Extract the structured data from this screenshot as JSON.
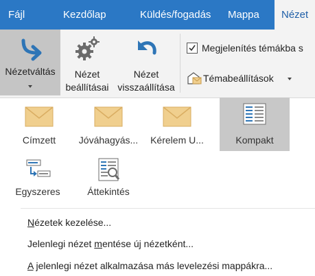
{
  "tabs": [
    {
      "label": "Fájl"
    },
    {
      "label": "Kezdőlap"
    },
    {
      "label": "Küldés/fogadás"
    },
    {
      "label": "Mappa"
    },
    {
      "label": "Nézet"
    }
  ],
  "ribbon": {
    "change_view": {
      "label": "Nézetváltás"
    },
    "view_settings": {
      "line1": "Nézet",
      "line2": "beállításai"
    },
    "reset_view": {
      "line1": "Nézet",
      "line2": "visszaállítása"
    },
    "show_as_conversations": {
      "label": "Megjelenítés témákba s",
      "checked": true
    },
    "conversation_settings": {
      "label": "Témabeállítások"
    }
  },
  "gallery": [
    {
      "label": "Címzett",
      "icon": "envelope-icon"
    },
    {
      "label": "Jóváhagyás...",
      "icon": "envelope-icon"
    },
    {
      "label": "Kérelem U...",
      "icon": "envelope-icon"
    },
    {
      "label": "Kompakt",
      "icon": "compact-list-icon",
      "selected": true
    },
    {
      "label": "Egyszeres",
      "icon": "single-view-icon"
    },
    {
      "label": "Áttekintés",
      "icon": "preview-icon"
    }
  ],
  "menu": {
    "manage_views": {
      "pre": "",
      "accel": "N",
      "post": "ézetek kezelése..."
    },
    "save_view": {
      "pre": "Jelenlegi nézet ",
      "accel": "m",
      "post": "entése új nézetként..."
    },
    "apply_view": {
      "pre": "",
      "accel": "A",
      "post": " jelenlegi nézet alkalmazása más levelezési mappákra..."
    }
  },
  "colors": {
    "tabbar": "#2b78c5",
    "ribbon": "#f3f3f3",
    "selected": "#c8c8c8",
    "accent": "#2e75b6",
    "envelope": "#f0cf8e"
  }
}
